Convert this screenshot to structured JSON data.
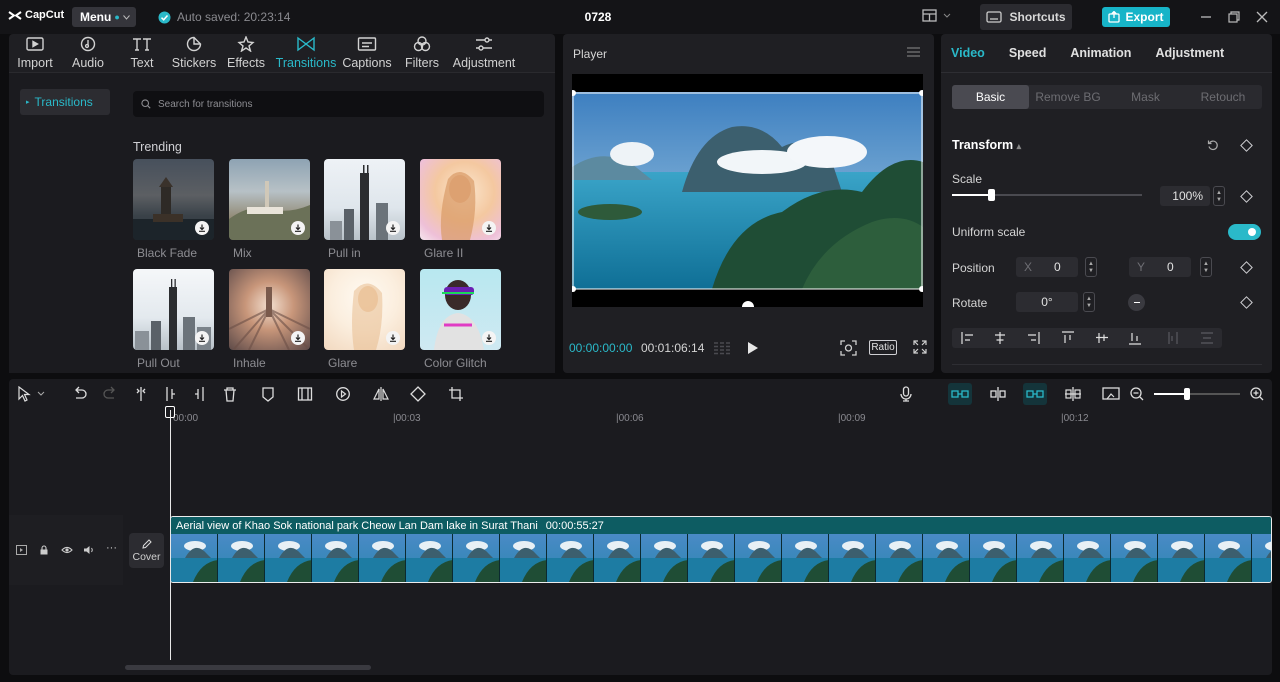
{
  "app": {
    "logo_text": "CapCut",
    "menu_label": "Menu",
    "autosave": "Auto saved: 20:23:14",
    "project_title": "0728",
    "shortcuts_label": "Shortcuts",
    "export_label": "Export"
  },
  "colors": {
    "accent": "#2ab9c9",
    "export": "#17b4c8",
    "clip": "#0d5c62"
  },
  "toolbar": {
    "items": [
      {
        "label": "Import",
        "icon": "import-icon"
      },
      {
        "label": "Audio",
        "icon": "audio-icon"
      },
      {
        "label": "Text",
        "icon": "text-icon"
      },
      {
        "label": "Stickers",
        "icon": "stickers-icon"
      },
      {
        "label": "Effects",
        "icon": "effects-icon"
      },
      {
        "label": "Transitions",
        "icon": "transitions-icon",
        "active": true
      },
      {
        "label": "Captions",
        "icon": "captions-icon"
      },
      {
        "label": "Filters",
        "icon": "filters-icon"
      },
      {
        "label": "Adjustment",
        "icon": "adjustment-icon"
      }
    ]
  },
  "sidebar": {
    "active_item": "Transitions"
  },
  "search": {
    "placeholder": "Search for transitions"
  },
  "transitions": {
    "section_title": "Trending",
    "items": [
      {
        "label": "Black Fade"
      },
      {
        "label": "Mix"
      },
      {
        "label": "Pull in"
      },
      {
        "label": "Glare II"
      },
      {
        "label": "Pull Out"
      },
      {
        "label": "Inhale"
      },
      {
        "label": "Glare"
      },
      {
        "label": "Color Glitch"
      }
    ]
  },
  "player": {
    "title": "Player",
    "current_time": "00:00:00:00",
    "total_time": "00:01:06:14",
    "ratio_label": "Ratio"
  },
  "properties": {
    "tabs": [
      "Video",
      "Speed",
      "Animation",
      "Adjustment"
    ],
    "active_tab": "Video",
    "subtabs": [
      "Basic",
      "Remove BG",
      "Mask",
      "Retouch"
    ],
    "active_subtab": "Basic",
    "transform_label": "Transform",
    "scale_label": "Scale",
    "scale_value": "100%",
    "uniform_scale_label": "Uniform scale",
    "uniform_scale_on": true,
    "position_label": "Position",
    "position_x_label": "X",
    "position_x": "0",
    "position_y_label": "Y",
    "position_y": "0",
    "rotate_label": "Rotate",
    "rotate_value": "0°"
  },
  "timeline": {
    "ruler": [
      "00:00",
      "|00:03",
      "|00:06",
      "|00:09",
      "|00:12"
    ],
    "cover_label": "Cover",
    "clip_title": "Aerial view of Khao Sok national park Cheow Lan Dam lake in Surat Thani",
    "clip_duration": "00:00:55:27"
  }
}
